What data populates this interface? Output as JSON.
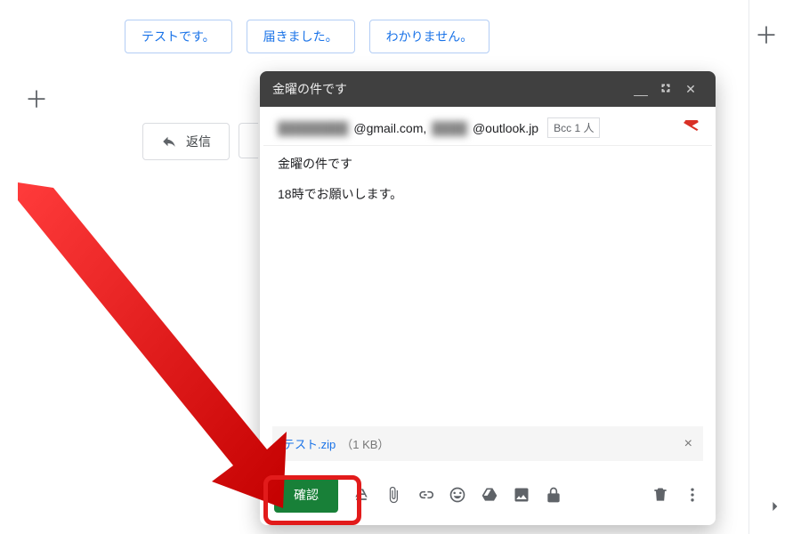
{
  "chips": [
    "テストです。",
    "届きました。",
    "わかりません。"
  ],
  "reply_label": "返信",
  "compose": {
    "title": "金曜の件です",
    "recipients": {
      "r1_hidden": "████████",
      "r1_domain": "@gmail.com,",
      "r2_hidden": "████",
      "r2_domain": "@outlook.jp",
      "bcc": "Bcc 1 人"
    },
    "subject": "金曜の件です",
    "body_line": "18時でお願いします。",
    "attachment": {
      "name": "テスト.zip",
      "size": "（1 KB）"
    },
    "send_label": "確認"
  }
}
